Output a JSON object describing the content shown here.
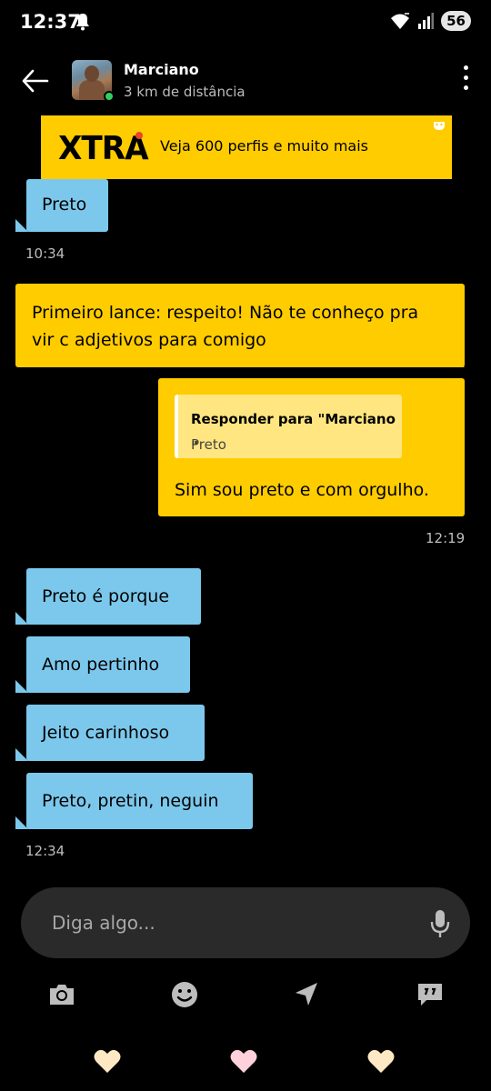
{
  "status_bar": {
    "time": "12:37",
    "battery": "56"
  },
  "header": {
    "name": "Marciano",
    "distance": "3 km de distância"
  },
  "banner": {
    "logo": "XTRA",
    "text": "Veja 600 perfis e muito mais"
  },
  "messages": [
    {
      "text": "Preto",
      "from": "them"
    },
    {
      "timestamp": "10:34"
    },
    {
      "text_line1": "Primeiro lance: respeito! Não te conheço pra",
      "text_line2": "vir c adjetivos para comigo",
      "from": "me"
    },
    {
      "reply_title": "Responder para \"Marciano \"",
      "reply_text": "Preto",
      "text": "Sim sou preto e com orgulho.",
      "from": "me"
    },
    {
      "timestamp": "12:19"
    },
    {
      "text": "Preto é porque",
      "from": "them"
    },
    {
      "text": "Amo pertinho",
      "from": "them"
    },
    {
      "text": "Jeito carinhoso",
      "from": "them"
    },
    {
      "text": "Preto, pretin, neguin",
      "from": "them"
    },
    {
      "timestamp": "12:34"
    }
  ],
  "composer": {
    "placeholder": "Diga algo..."
  },
  "toolbar_icons": [
    "camera-icon",
    "emoji-icon",
    "location-icon",
    "quick-phrases-icon"
  ],
  "nav_icons": [
    "heart-icon-left",
    "heart-icon-center",
    "heart-icon-right"
  ],
  "colors": {
    "them_bubble": "#7cc8ec",
    "me_bubble": "#ffcc00",
    "background": "#000000",
    "online": "#2fd15b"
  }
}
